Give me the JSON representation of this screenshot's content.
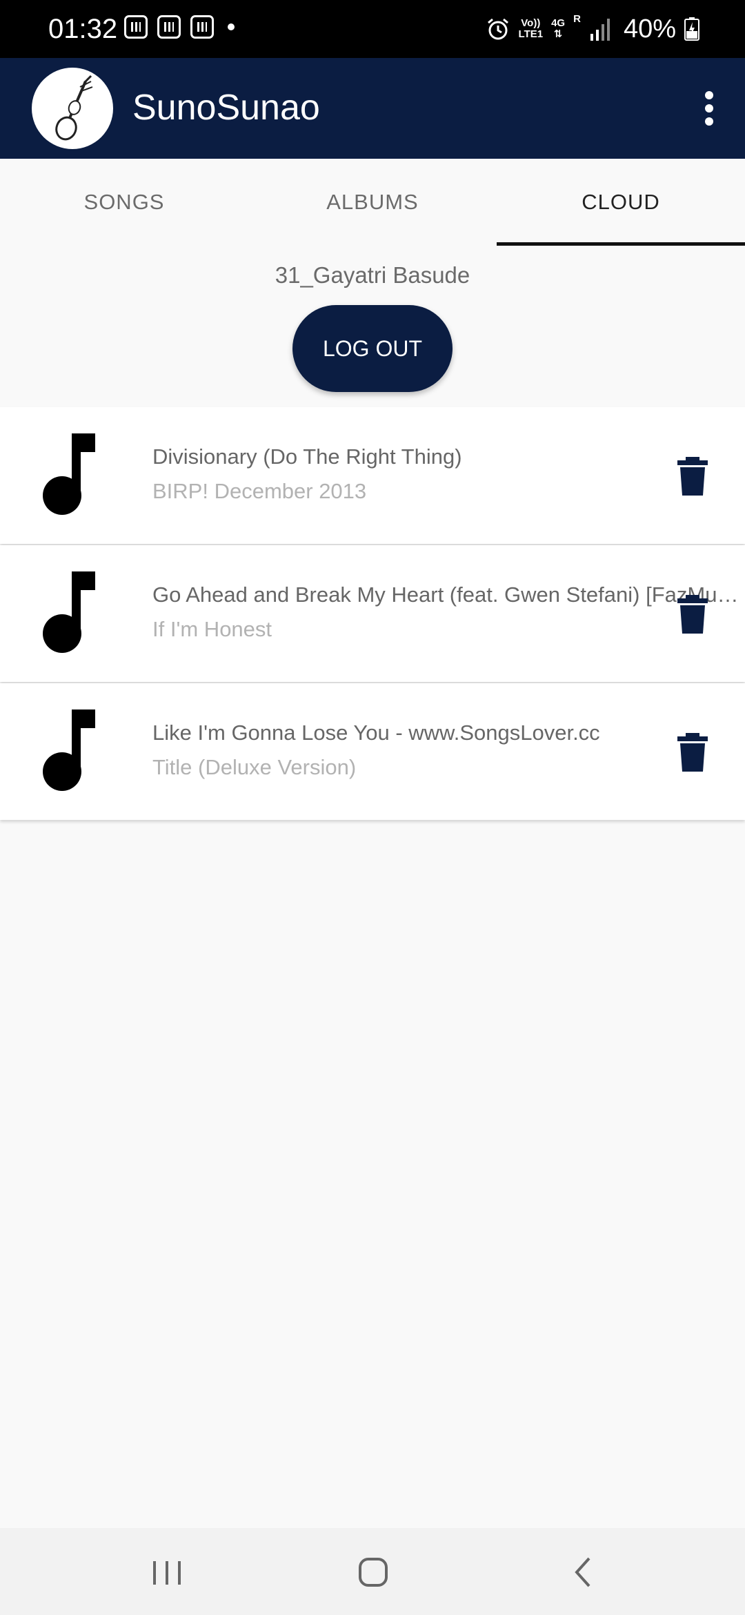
{
  "status_bar": {
    "time": "01:32",
    "net_top": "Vo))",
    "net_bottom": "LTE1",
    "net_gen": "4G",
    "roaming": "R",
    "battery": "40%"
  },
  "app": {
    "title": "SunoSunao"
  },
  "tabs": [
    {
      "label": "SONGS"
    },
    {
      "label": "ALBUMS"
    },
    {
      "label": "CLOUD"
    }
  ],
  "cloud": {
    "user_name": "31_Gayatri Basude",
    "logout_label": "LOG OUT",
    "songs": [
      {
        "title": "Divisionary (Do The Right Thing)",
        "subtitle": "BIRP! December 2013"
      },
      {
        "title": "Go Ahead and Break My Heart (feat. Gwen Stefani) [FazMusic]",
        "subtitle": "If I'm Honest"
      },
      {
        "title": "Like I'm Gonna Lose You - www.SongsLover.cc",
        "subtitle": "Title (Deluxe Version)"
      }
    ]
  },
  "colors": {
    "primary": "#0b1d42",
    "background": "#f9f9f9"
  },
  "icons": [
    "music-note-icon",
    "delete-icon",
    "overflow-menu-icon",
    "recents-icon",
    "home-icon",
    "back-icon"
  ]
}
